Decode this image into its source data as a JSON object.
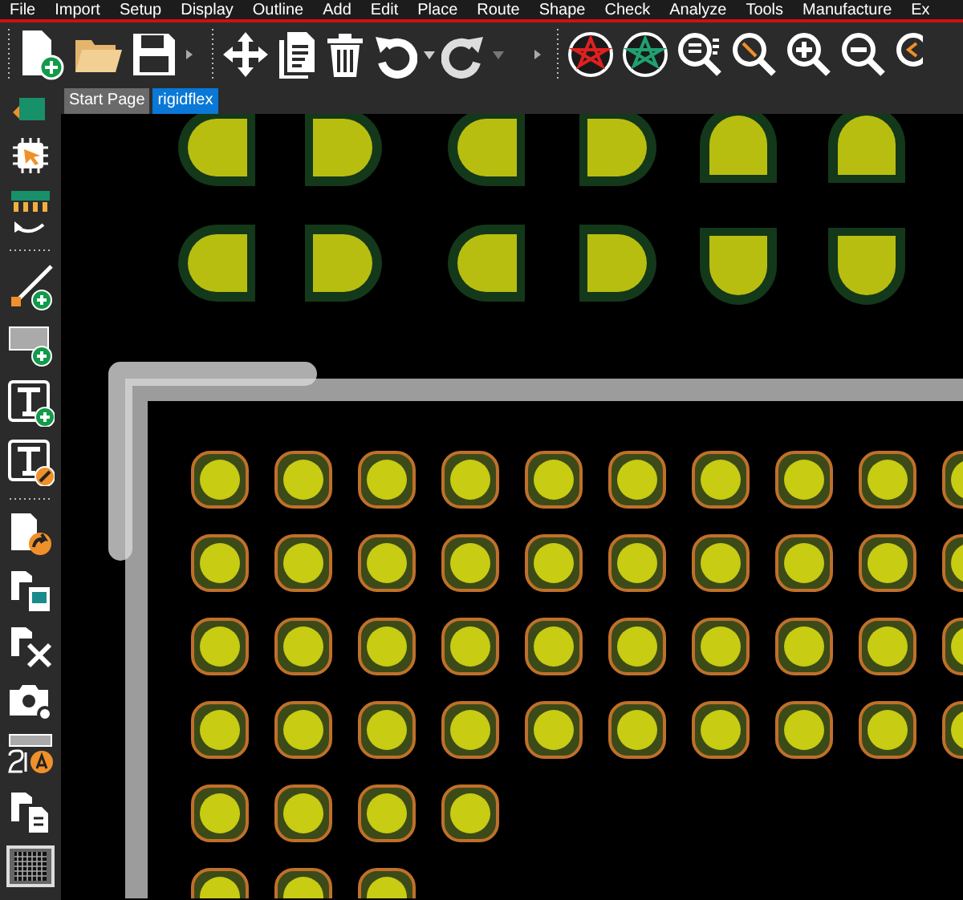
{
  "menu_bar": [
    {
      "label": "File"
    },
    {
      "label": "Import"
    },
    {
      "label": "Setup"
    },
    {
      "label": "Display"
    },
    {
      "label": "Outline"
    },
    {
      "label": "Add"
    },
    {
      "label": "Edit"
    },
    {
      "label": "Place"
    },
    {
      "label": "Route"
    },
    {
      "label": "Shape"
    },
    {
      "label": "Check"
    },
    {
      "label": "Analyze"
    },
    {
      "label": "Tools"
    },
    {
      "label": "Manufacture"
    },
    {
      "label": "Ex"
    }
  ],
  "tabs": [
    {
      "label": "Start Page",
      "selected": false
    },
    {
      "label": "rigidflex",
      "selected": true
    }
  ]
}
